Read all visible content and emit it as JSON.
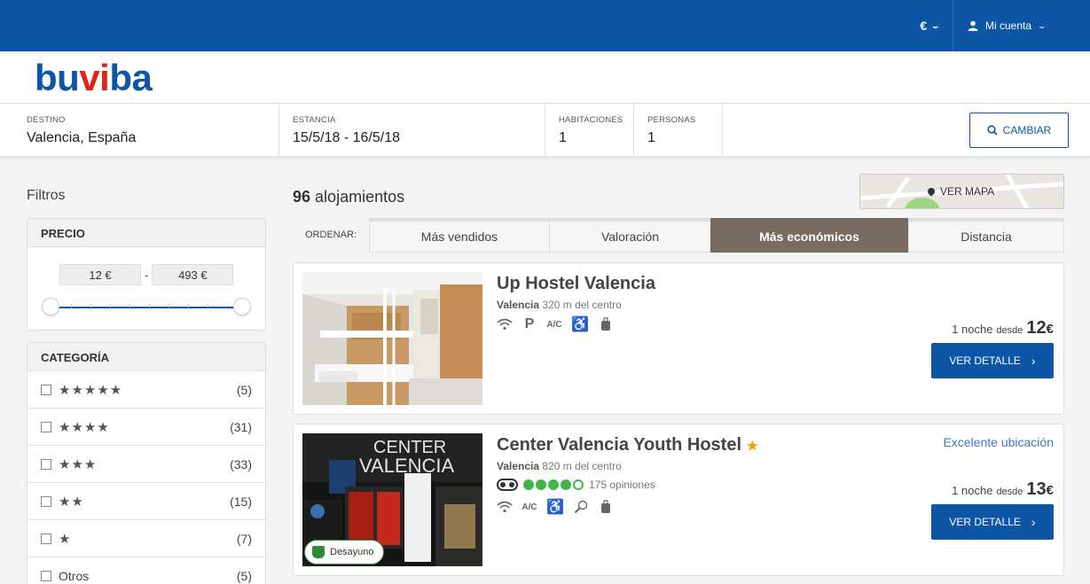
{
  "header": {
    "currency": "€",
    "account_label": "Mi cuenta"
  },
  "logo": {
    "part1": "bu",
    "part2": "vi",
    "part3": "ba"
  },
  "search": {
    "destino_label": "DESTINO",
    "destino_value": "Valencia, España",
    "estancia_label": "ESTANCIA",
    "estancia_value": "15/5/18 - 16/5/18",
    "habitaciones_label": "HABITACIONES",
    "habitaciones_value": "1",
    "personas_label": "PERSONAS",
    "personas_value": "1",
    "change_button": "CAMBIAR"
  },
  "filters": {
    "title": "Filtros",
    "price": {
      "heading": "PRECIO",
      "min": "12 €",
      "max": "493 €"
    },
    "category": {
      "heading": "CATEGORÍA",
      "rows": [
        {
          "stars": "★★★★★",
          "count": "(5)"
        },
        {
          "stars": "★★★★",
          "count": "(31)"
        },
        {
          "stars": "★★★",
          "count": "(33)"
        },
        {
          "stars": "★★",
          "count": "(15)"
        },
        {
          "stars": "★",
          "count": "(7)"
        },
        {
          "label": "Otros",
          "count": "(5)"
        }
      ]
    }
  },
  "results": {
    "count": "96",
    "count_suffix": "alojamientos",
    "map_button": "VER MAPA",
    "sort_label": "ORDENAR:",
    "sort_tabs": [
      "Más vendidos",
      "Valoración",
      "Más económicos",
      "Distancia"
    ],
    "active_sort": "Más económicos",
    "hotels": [
      {
        "name": "Up Hostel Valencia",
        "city": "Valencia",
        "distance": "320 m del centro",
        "amenities": [
          "wifi-icon",
          "parking-icon",
          "ac-icon",
          "accessible-icon",
          "luggage-icon"
        ],
        "price_prefix": "1 noche",
        "price_from": "desde",
        "price": "12",
        "currency": "€",
        "button": "VER DETALLE"
      },
      {
        "name": "Center Valencia Youth Hostel",
        "category_stars": "★",
        "rating_tag": "Excelente ubicación",
        "city": "Valencia",
        "distance": "820 m del centro",
        "tripadvisor_rating": 4,
        "tripadvisor_max": 5,
        "reviews": "175 opiniones",
        "amenities": [
          "wifi-icon",
          "ac-icon",
          "accessible-icon",
          "tennis-icon",
          "luggage-icon"
        ],
        "badge": "Desayuno",
        "price_prefix": "1 noche",
        "price_from": "desde",
        "price": "13",
        "currency": "€",
        "button": "VER DETALLE",
        "image_sign_line1": "CENTER",
        "image_sign_line2": "VALENCIA"
      }
    ]
  },
  "colors": {
    "brand_blue": "#0d56a6",
    "brand_red": "#e2231a",
    "active_tab": "#786b5f",
    "tripadvisor_green": "#3fb54a"
  }
}
